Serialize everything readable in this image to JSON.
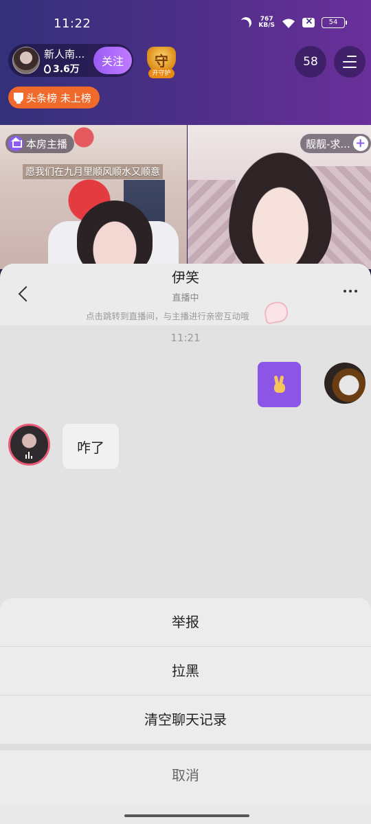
{
  "status_bar": {
    "time": "11:22",
    "net_speed_value": "767",
    "net_speed_unit": "KB/S",
    "battery": "54"
  },
  "live_room": {
    "host_name": "新人南...",
    "host_fans": "3.6万",
    "follow_label": "关注",
    "guard_symbol": "守",
    "guard_label": "开守护",
    "viewer_count": "58",
    "rank_label": "头条榜 未上榜",
    "home_host_tag": "本房主播",
    "peer_host_tag": "靓靓-求...",
    "peer_add_label": "+",
    "wish_text": "愿我们在九月里顺风顺水又顺意"
  },
  "chat": {
    "title": "伊笑",
    "status": "直播中",
    "hint": "点击跳转到直播间，与主播进行亲密互动哦",
    "timestamp": "11:21",
    "messages": [
      {
        "from": "me",
        "type": "emoji",
        "content": "victory-hand"
      },
      {
        "from": "peer",
        "type": "text",
        "content": "咋了"
      }
    ]
  },
  "action_sheet": {
    "items": [
      "举报",
      "拉黑",
      "清空聊天记录"
    ],
    "cancel": "取消"
  },
  "colors": {
    "accent_purple": "#8d55e6",
    "rank_orange": "#ef6a2b",
    "peer_ring_pink": "#e85a78"
  }
}
